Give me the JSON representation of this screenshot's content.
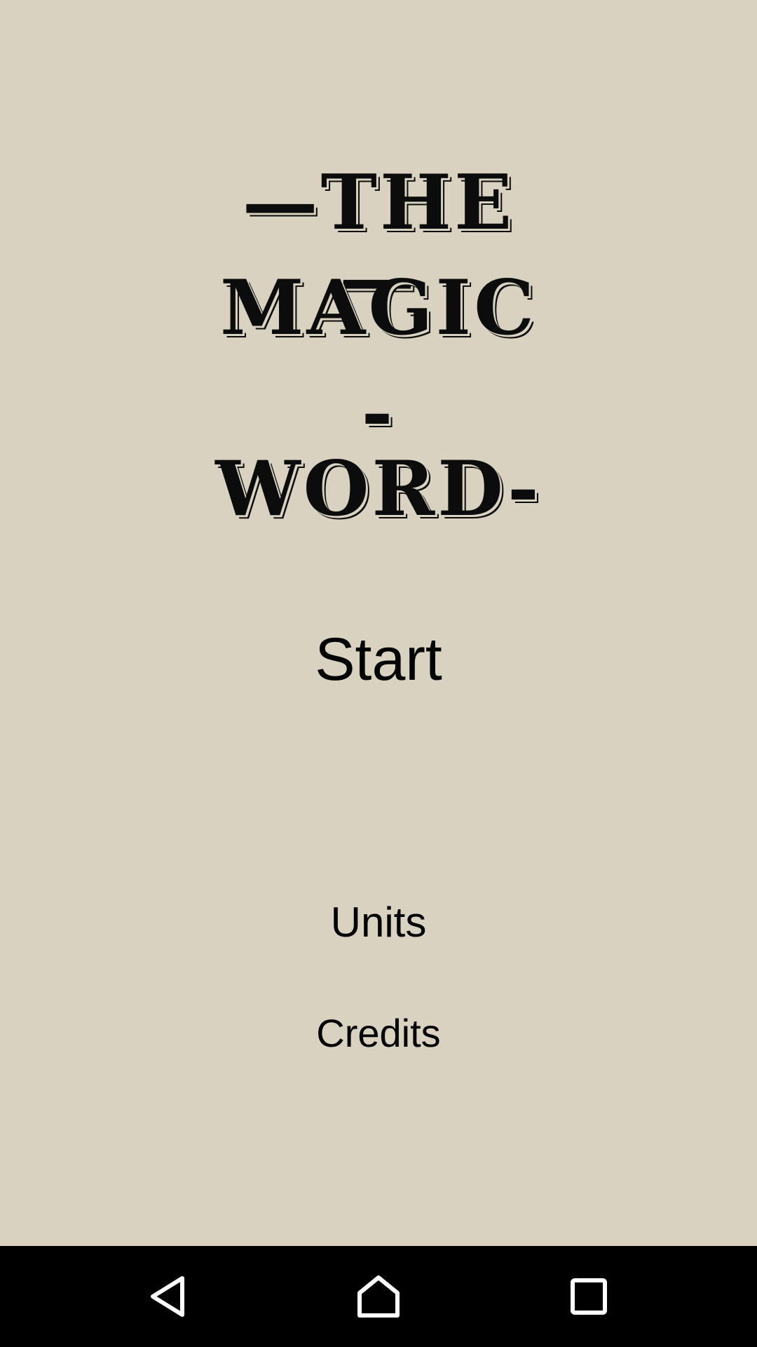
{
  "app": {
    "title_lines": [
      "—THE—",
      "MAGIC",
      "-WORD-"
    ]
  },
  "menu": {
    "start_label": "Start",
    "units_label": "Units",
    "credits_label": "Credits"
  },
  "navbar": {
    "icons": [
      "back-icon",
      "home-icon",
      "recents-icon"
    ]
  },
  "colors": {
    "background": "#d9d2c1",
    "text": "#000000",
    "navbar": "#000000"
  }
}
